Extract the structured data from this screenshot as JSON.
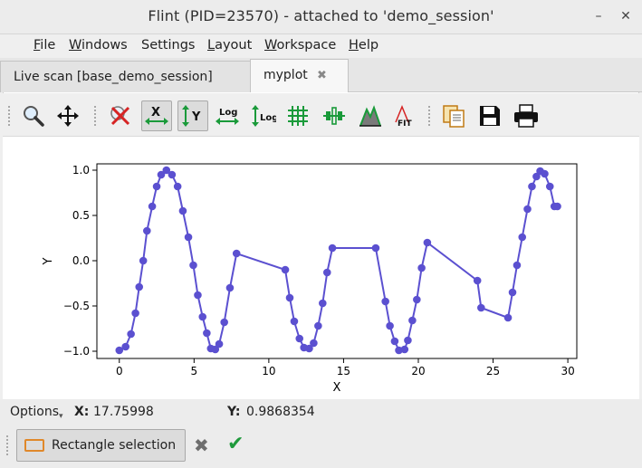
{
  "window": {
    "title": "Flint (PID=23570) - attached to 'demo_session'",
    "minimize": "–",
    "close": "✕"
  },
  "menu": {
    "items": [
      {
        "label": "File",
        "mnemonic": "F",
        "rest": "ile"
      },
      {
        "label": "Windows",
        "mnemonic": "W",
        "rest": "indows"
      },
      {
        "label": "Settings",
        "mnemonic": "",
        "rest": "Settings"
      },
      {
        "label": "Layout",
        "mnemonic": "L",
        "rest": "ayout"
      },
      {
        "label": "Workspace",
        "mnemonic": "W",
        "rest": "orkspace"
      },
      {
        "label": "Help",
        "mnemonic": "H",
        "rest": "elp"
      }
    ]
  },
  "tabs": [
    {
      "label": "Live scan [base_demo_session]",
      "active": false
    },
    {
      "label": "myplot",
      "active": true,
      "close": "✖"
    }
  ],
  "toolbar": {
    "icons": [
      "zoom-icon",
      "pan-icon",
      "reset-zoom-icon",
      "autoscale-x-icon",
      "autoscale-y-icon",
      "log-x-icon",
      "log-y-icon",
      "grid-icon",
      "curve-style-icon",
      "colormap-icon",
      "fit-icon",
      "copy-icon",
      "save-icon",
      "print-icon"
    ],
    "checked": [
      "autoscale-x-icon",
      "autoscale-y-icon"
    ],
    "labels": {
      "x": "X",
      "y": "Y",
      "logx": "Log",
      "logy": "Log",
      "fit": "FIT"
    }
  },
  "status": {
    "options_label": "Options",
    "x_label": "X:",
    "x_value": "17.75998",
    "y_label": "Y:",
    "y_value": "0.9868354"
  },
  "selection": {
    "rect_label": "Rectangle selection",
    "cancel": "✖",
    "confirm": "✔"
  },
  "colors": {
    "line": "#5b50d0",
    "marker": "#5b50d0",
    "cancel": "#6e6e6e",
    "confirm": "#1f9a3c",
    "rect_border": "#e0882a"
  },
  "chart_data": {
    "type": "line",
    "xlabel": "X",
    "ylabel": "Y",
    "xlim": [
      -1.5,
      30.6
    ],
    "ylim": [
      -1.08,
      1.07
    ],
    "x_ticks": [
      0,
      5,
      10,
      15,
      20,
      25,
      30
    ],
    "y_ticks": [
      1.0,
      0.5,
      0.0,
      -0.5,
      -1.0
    ],
    "x_tick_labels": [
      "0",
      "5",
      "10",
      "15",
      "20",
      "25",
      "30"
    ],
    "y_tick_labels": [
      "1.0",
      "0.5",
      "0.0",
      "−0.5",
      "−1.0"
    ],
    "grid": false,
    "series": [
      {
        "x": [
          0.0,
          0.42,
          0.78,
          1.08,
          1.33,
          1.6,
          1.85,
          2.2,
          2.5,
          2.8,
          3.15,
          3.52,
          3.9,
          4.25,
          4.62,
          4.95,
          5.25,
          5.57,
          5.85,
          6.12,
          6.42,
          6.68,
          7.02,
          7.4,
          7.84,
          11.1,
          11.4,
          11.7,
          12.05,
          12.35,
          12.7,
          13.0,
          13.3,
          13.6,
          13.9,
          14.25,
          17.15,
          17.8,
          18.1,
          18.42,
          18.7,
          19.08,
          19.3,
          19.6,
          19.9,
          20.22,
          20.6,
          23.95,
          24.2,
          26.0,
          26.3,
          26.6,
          26.95,
          27.3,
          27.6,
          27.9,
          28.15,
          28.45,
          28.8,
          29.1,
          29.3
        ],
        "y": [
          -0.99,
          -0.95,
          -0.81,
          -0.58,
          -0.29,
          0.0,
          0.33,
          0.6,
          0.82,
          0.95,
          1.0,
          0.95,
          0.82,
          0.55,
          0.26,
          -0.05,
          -0.38,
          -0.62,
          -0.8,
          -0.97,
          -0.98,
          -0.92,
          -0.68,
          -0.3,
          0.08,
          -0.1,
          -0.41,
          -0.67,
          -0.86,
          -0.96,
          -0.97,
          -0.91,
          -0.72,
          -0.47,
          -0.13,
          0.14,
          0.14,
          -0.45,
          -0.72,
          -0.89,
          -0.99,
          -0.98,
          -0.88,
          -0.66,
          -0.43,
          -0.08,
          0.2,
          -0.22,
          -0.52,
          -0.63,
          -0.35,
          -0.05,
          0.26,
          0.57,
          0.82,
          0.93,
          0.99,
          0.96,
          0.82,
          0.6,
          0.6
        ]
      }
    ]
  }
}
